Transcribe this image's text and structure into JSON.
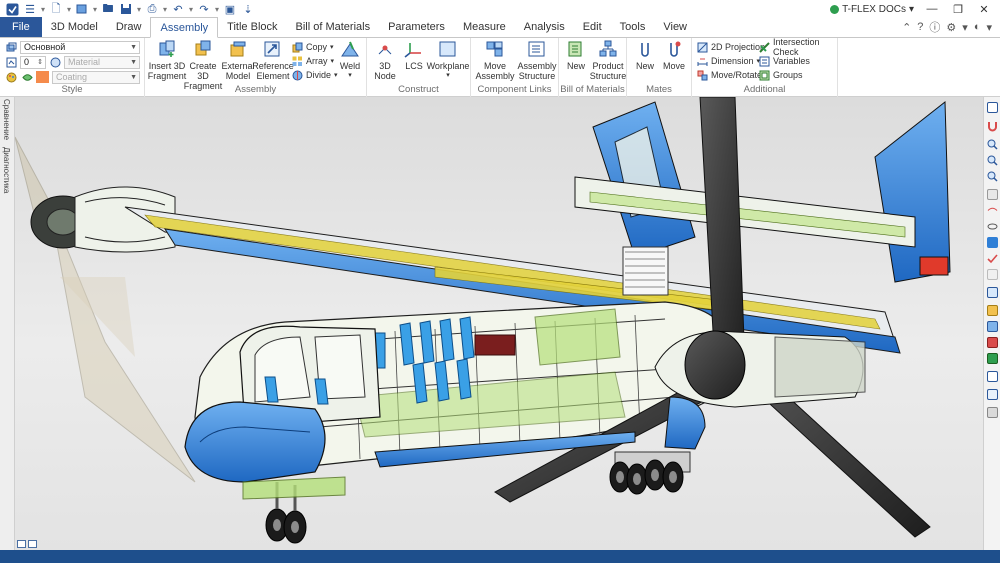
{
  "app": {
    "brand": "T-FLEX DOCs"
  },
  "tabs": [
    {
      "label": "File",
      "active": false
    },
    {
      "label": "3D Model",
      "active": false
    },
    {
      "label": "Draw",
      "active": false
    },
    {
      "label": "Assembly",
      "active": true
    },
    {
      "label": "Title Block",
      "active": false
    },
    {
      "label": "Bill of Materials",
      "active": false
    },
    {
      "label": "Parameters",
      "active": false
    },
    {
      "label": "Measure",
      "active": false
    },
    {
      "label": "Analysis",
      "active": false
    },
    {
      "label": "Edit",
      "active": false
    },
    {
      "label": "Tools",
      "active": false
    },
    {
      "label": "View",
      "active": false
    }
  ],
  "ribbon": {
    "style": {
      "label": "Style",
      "layer_value": "Основной",
      "level_value": "0",
      "material_placeholder": "Material",
      "coating_placeholder": "Coating",
      "coating_color": "#f58b4c"
    },
    "assembly": {
      "label": "Assembly",
      "insert_fragment": "Insert 3D\nFragment",
      "create_fragment": "Create 3D\nFragment",
      "external_model": "External\nModel",
      "reference_element": "Reference\nElement",
      "copy": "Copy",
      "array": "Array",
      "divide": "Divide",
      "weld": "Weld"
    },
    "construct": {
      "label": "Construct",
      "node": "3D\nNode",
      "lcs": "LCS",
      "workplane": "Workplane"
    },
    "component_links": {
      "label": "Component Links",
      "move_assembly": "Move\nAssembly",
      "assembly_structure": "Assembly\nStructure"
    },
    "bom": {
      "label": "Bill of Materials",
      "new": "New",
      "product_structure": "Product\nStructure"
    },
    "mates": {
      "label": "Mates",
      "new": "New",
      "move": "Move"
    },
    "additional": {
      "label": "Additional",
      "projection": "2D Projection",
      "dimension": "Dimension",
      "move_rotate": "Move/Rotate",
      "intersection": "Intersection Check",
      "variables": "Variables",
      "groups": "Groups"
    }
  },
  "sidebar": {
    "tab1": "Сравнение",
    "tab2": "Диагностика"
  },
  "colors": {
    "ribbon_accent": "#2b579a",
    "status_bar": "#1e4f8c",
    "model_blue": "#2f7fd6",
    "model_green": "#b5e07a"
  }
}
